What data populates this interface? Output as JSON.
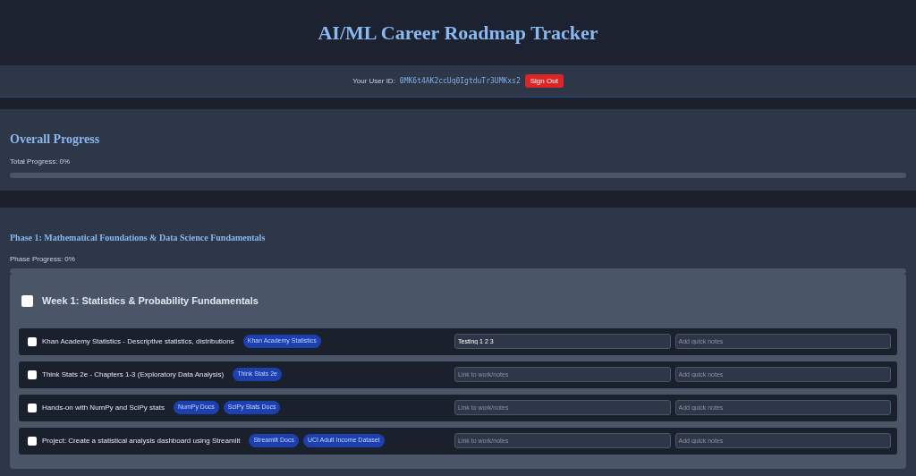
{
  "title": "AI/ML Career Roadmap Tracker",
  "user_bar": {
    "label": "Your User ID:",
    "user_id": "0MK6t4AK2ccUq0IgtduTr3UMKxs2",
    "sign_out": "Sign Out"
  },
  "overall": {
    "heading": "Overall Progress",
    "label": "Total Progress: 0%",
    "level": 0
  },
  "phase": {
    "heading": "Phase 1: Mathematical Foundations & Data Science Fundamentals",
    "label": "Phase Progress: 0%",
    "level": 0,
    "week": {
      "title": "Week 1: Statistics & Probability Fundamentals",
      "checked": false,
      "tasks": [
        {
          "text": "Khan Academy Statistics - Descriptive statistics, distributions",
          "checked": false,
          "tags": [
            "Khan Academy Statistics"
          ],
          "link": {
            "value": "Testing 1 2 3"
          },
          "notes": {
            "placeholder": "Add quick notes"
          }
        },
        {
          "text": "Think Stats 2e - Chapters 1-3 (Exploratory Data Analysis)",
          "checked": false,
          "tags": [
            "Think Stats 2e"
          ],
          "link": {
            "placeholder": "Link to work/notes"
          },
          "notes": {
            "placeholder": "Add quick notes"
          }
        },
        {
          "text": "Hands-on with NumPy and SciPy stats",
          "checked": false,
          "tags": [
            "NumPy Docs",
            "SciPy Stats Docs"
          ],
          "link": {
            "placeholder": "Link to work/notes"
          },
          "notes": {
            "placeholder": "Add quick notes"
          }
        },
        {
          "text": "Project: Create a statistical analysis dashboard using Streamlit",
          "checked": false,
          "tags": [
            "Streamlit Docs",
            "UCI Adult Income Dataset"
          ],
          "link": {
            "placeholder": "Link to work/notes"
          },
          "notes": {
            "placeholder": "Add quick notes"
          }
        }
      ]
    }
  }
}
